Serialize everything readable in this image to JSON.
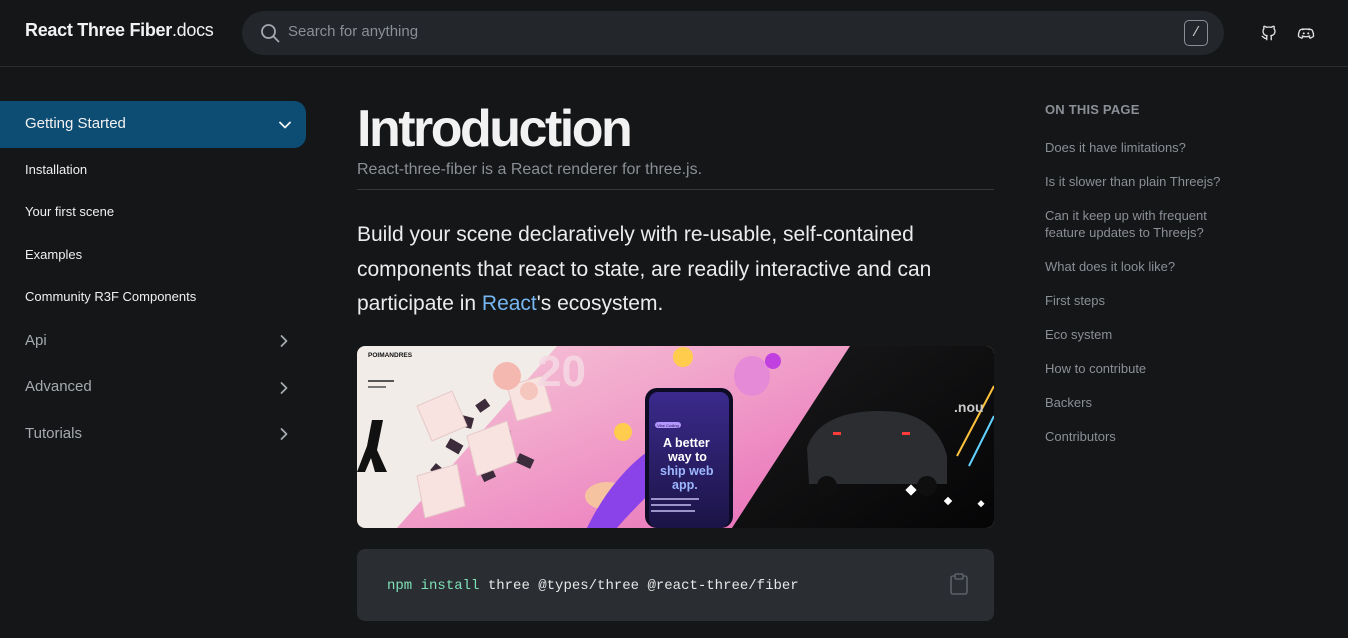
{
  "header": {
    "logo_brand": "React Three Fiber",
    "logo_suffix": ".docs",
    "search_placeholder": "Search for anything",
    "search_shortcut": "/",
    "icons": [
      "github-icon",
      "discord-icon"
    ]
  },
  "sidebar": {
    "active_section": "Getting Started",
    "sub_items": [
      "Installation",
      "Your first scene",
      "Examples",
      "Community R3F Components"
    ],
    "sections": [
      "Api",
      "Advanced",
      "Tutorials"
    ]
  },
  "main": {
    "title": "Introduction",
    "subtitle": "React-three-fiber is a React renderer for three.js.",
    "lead_before": "Build your scene declaratively with re-usable, self-contained components that react to state, are readily interactive and can participate in ",
    "lead_link": "React",
    "lead_after": "'s ecosystem.",
    "hero": {
      "brand": "POIMANDRES",
      "phone_badge": "Vibe Coding",
      "phone_headline_1": "A better",
      "phone_headline_2": "way to",
      "phone_headline_3": "ship web",
      "phone_headline_4": "app.",
      "right_text": ".nou",
      "big_text": "20"
    },
    "code": {
      "cmd": "npm",
      "sub": "install",
      "args": " three @types/three @react-three/fiber"
    }
  },
  "toc": {
    "title": "ON THIS PAGE",
    "items": [
      "Does it have limitations?",
      "Is it slower than plain Threejs?",
      "Can it keep up with frequent feature updates to Threejs?",
      "What does it look like?",
      "First steps",
      "Eco system",
      "How to contribute",
      "Backers",
      "Contributors"
    ]
  },
  "colors": {
    "background": "#141618",
    "accent_nav": "#0d4d73",
    "link": "#76b7f2",
    "code_cmd": "#7ee2b8"
  }
}
